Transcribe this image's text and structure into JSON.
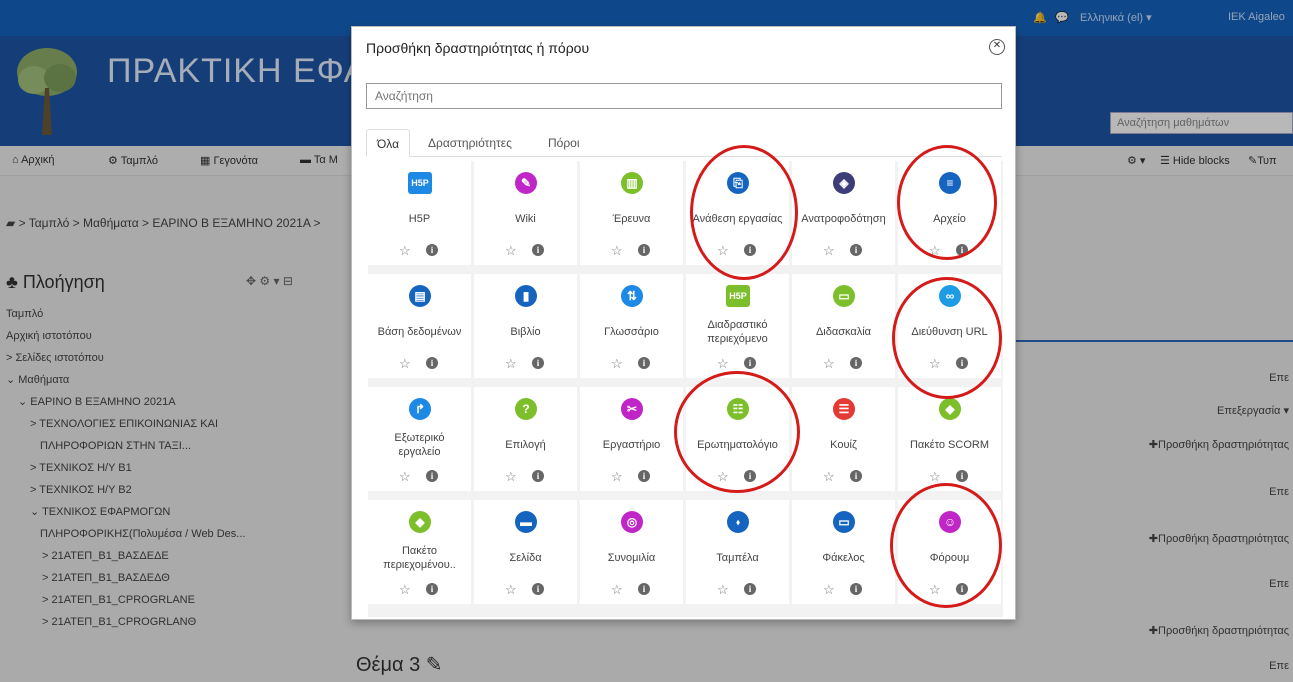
{
  "topbar": {
    "language": "Ελληνικά (el) ▾",
    "user": "IEK Aigaleo"
  },
  "banner": {
    "site_title": "ΠΡΑΚΤΙΚΗ ΕΦΑ",
    "course_search_placeholder": "Αναζήτηση μαθημάτων"
  },
  "navbar": {
    "home": "Αρχική",
    "dashboard": "Ταμπλό",
    "events": "Γεγονότα",
    "courses": "Τα Μ",
    "hide_blocks": "Hide blocks",
    "tools": "Τυπ"
  },
  "breadcrumb": "> Ταμπλό > Μαθήματα > ΕΑΡΙΝΟ Β ΕΞΑΜΗΝΟ 2021Α >",
  "navigation": {
    "title": "Πλοήγηση",
    "items": [
      "Ταμπλό",
      "Αρχική ιστοτόπου",
      "> Σελίδες ιστοτόπου",
      "⌄ Μαθήματα",
      "⌄ ΕΑΡΙΝΟ Β ΕΞΑΜΗΝΟ 2021Α",
      "> ΤΕΧΝΟΛΟΓΙΕΣ ΕΠΙΚΟΙΝΩΝΙΑΣ ΚΑΙ",
      "ΠΛΗΡΟΦΟΡΙΩΝ ΣΤΗΝ ΤΑΞΙ...",
      "> ΤΕΧΝΙΚΟΣ Η/Υ Β1",
      "> ΤΕΧΝΙΚΟΣ Η/Υ Β2",
      "⌄ ΤΕΧΝΙΚΟΣ ΕΦΑΡΜΟΓΩΝ",
      "ΠΛΗΡΟΦΟΡΙΚΗΣ(Πολυμέσα / Web Des...",
      "> 21ΑΤΕΠ_Β1_ΒΑΣΔΕΔΕ",
      "> 21ΑΤΕΠ_Β1_ΒΑΣΔΕΔΘ",
      "> 21ΑΤΕΠ_Β1_CPROGRLANE",
      "> 21ΑΤΕΠ_Β1_CPROGRLANΘ"
    ]
  },
  "right_panel": {
    "edit_short": "Επε",
    "edit_menu": "Επεξεργασία ▾",
    "add_activity": "✚Προσθήκη δραστηριότητας"
  },
  "topic": "Θέμα 3 ✎",
  "modal": {
    "title": "Προσθήκη δραστηριότητας ή πόρου",
    "search_placeholder": "Αναζήτηση",
    "tabs": [
      "Όλα",
      "Δραστηριότητες",
      "Πόροι"
    ],
    "items": [
      {
        "label": "H5P",
        "icon": "h5p-icon",
        "color": "#1e88e5"
      },
      {
        "label": "Wiki",
        "icon": "wiki-icon",
        "color": "#c026c7"
      },
      {
        "label": "Έρευνα",
        "icon": "survey-icon",
        "color": "#7cbf2a"
      },
      {
        "label": "Ανάθεση εργασίας",
        "icon": "assignment-icon",
        "color": "#1565c0"
      },
      {
        "label": "Ανατροφοδότηση",
        "icon": "feedback-icon",
        "color": "#3d3d7a"
      },
      {
        "label": "Αρχείο",
        "icon": "file-icon",
        "color": "#1565c0"
      },
      {
        "label": "Βάση δεδομένων",
        "icon": "database-icon",
        "color": "#1565c0"
      },
      {
        "label": "Βιβλίο",
        "icon": "book-icon",
        "color": "#1565c0"
      },
      {
        "label": "Γλωσσάριο",
        "icon": "glossary-icon",
        "color": "#1e88e5"
      },
      {
        "label": "Διαδραστικό περιεχόμενο",
        "icon": "h5p-interactive-icon",
        "color": "#7cbf2a"
      },
      {
        "label": "Διδασκαλία",
        "icon": "lesson-icon",
        "color": "#7cbf2a"
      },
      {
        "label": "Διεύθυνση URL",
        "icon": "url-icon",
        "color": "#1e9be5"
      },
      {
        "label": "Εξωτερικό εργαλείο",
        "icon": "external-tool-icon",
        "color": "#1e88e5"
      },
      {
        "label": "Επιλογή",
        "icon": "choice-icon",
        "color": "#7cbf2a"
      },
      {
        "label": "Εργαστήριο",
        "icon": "workshop-icon",
        "color": "#c026c7"
      },
      {
        "label": "Ερωτηματολόγιο",
        "icon": "questionnaire-icon",
        "color": "#7cbf2a"
      },
      {
        "label": "Κουίζ",
        "icon": "quiz-icon",
        "color": "#e53935"
      },
      {
        "label": "Πακέτο SCORM",
        "icon": "scorm-icon",
        "color": "#7cbf2a"
      },
      {
        "label": "Πακέτο περιεχομένου..",
        "icon": "ims-package-icon",
        "color": "#7cbf2a"
      },
      {
        "label": "Σελίδα",
        "icon": "page-icon",
        "color": "#1565c0"
      },
      {
        "label": "Συνομιλία",
        "icon": "chat-icon",
        "color": "#c026c7"
      },
      {
        "label": "Ταμπέλα",
        "icon": "label-icon",
        "color": "#1565c0"
      },
      {
        "label": "Φάκελος",
        "icon": "folder-icon",
        "color": "#1565c0"
      },
      {
        "label": "Φόρουμ",
        "icon": "forum-icon",
        "color": "#c026c7"
      }
    ]
  }
}
